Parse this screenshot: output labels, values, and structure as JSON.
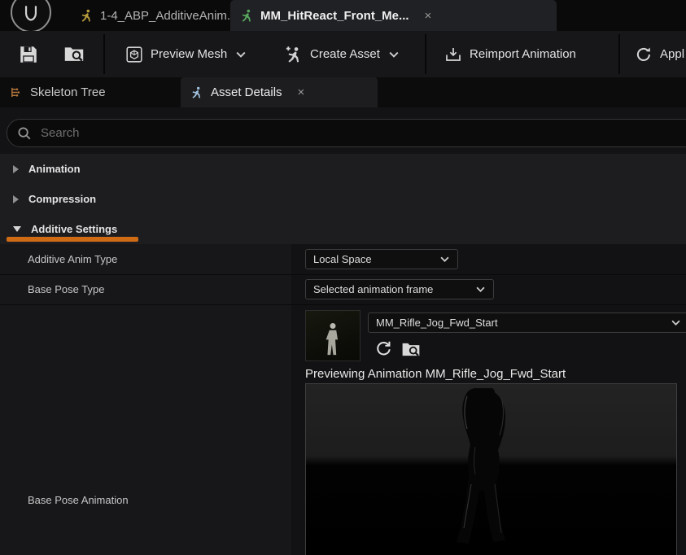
{
  "colors": {
    "accent_orange": "#cf6a15"
  },
  "titlebar": {
    "tabs": [
      {
        "label": "1-4_ABP_AdditiveAnim..."
      },
      {
        "label": "MM_HitReact_Front_Me..."
      }
    ],
    "close_glyph": "×"
  },
  "toolbar": {
    "preview_mesh_label": "Preview Mesh",
    "create_asset_label": "Create Asset",
    "reimport_label": "Reimport Animation",
    "apply_label": "Appl"
  },
  "panel_tabs": {
    "skeleton_tree_label": "Skeleton Tree",
    "asset_details_label": "Asset Details",
    "close_glyph": "×"
  },
  "search": {
    "placeholder": "Search"
  },
  "sections": [
    {
      "label": "Animation",
      "expanded": false
    },
    {
      "label": "Compression",
      "expanded": false
    },
    {
      "label": "Additive Settings",
      "expanded": true
    }
  ],
  "properties": [
    {
      "label": "Additive Anim Type",
      "value": "Local Space"
    },
    {
      "label": "Base Pose Type",
      "value": "Selected animation frame"
    },
    {
      "label": "Base Pose Animation",
      "asset_name": "MM_Rifle_Jog_Fwd_Start",
      "preview_caption": "Previewing Animation MM_Rifle_Jog_Fwd_Start"
    }
  ]
}
